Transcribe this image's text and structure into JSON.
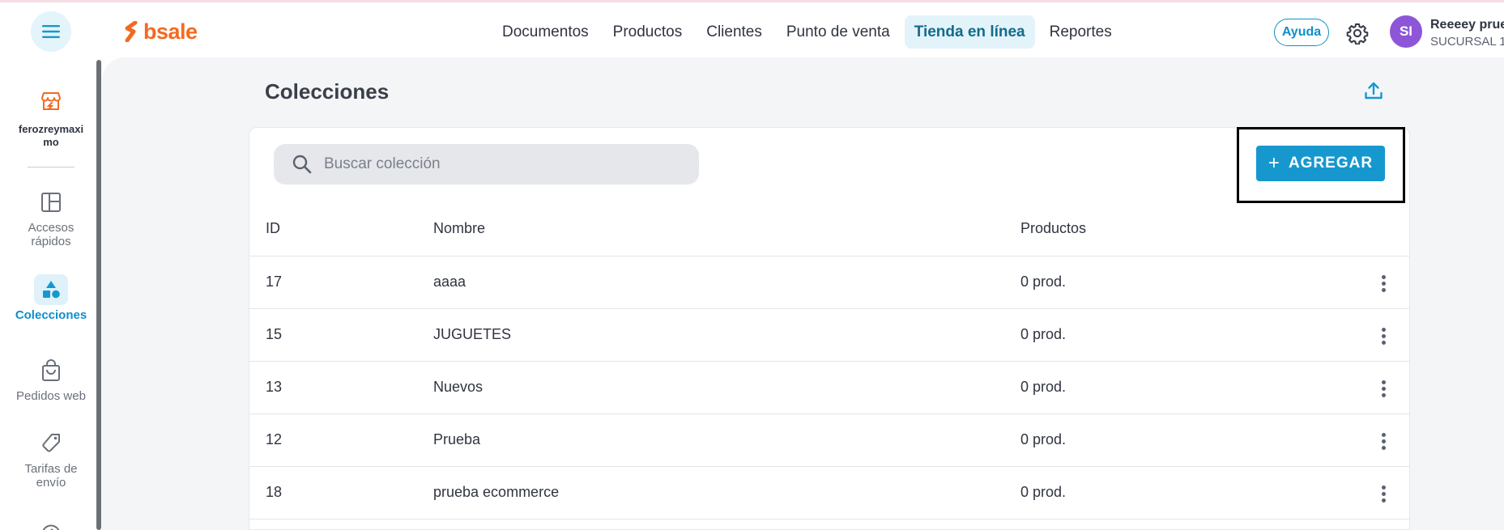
{
  "header": {
    "logo_text": "bsale",
    "nav": [
      {
        "label": "Documentos",
        "active": false
      },
      {
        "label": "Productos",
        "active": false
      },
      {
        "label": "Clientes",
        "active": false
      },
      {
        "label": "Punto de venta",
        "active": false
      },
      {
        "label": "Tienda en línea",
        "active": true
      },
      {
        "label": "Reportes",
        "active": false
      }
    ],
    "help_label": "Ayuda",
    "avatar_initials": "SI",
    "user_name": "Reeeey prue",
    "user_branch": "SUCURSAL 1"
  },
  "sidebar": {
    "store_name": "ferozreymaxi mo",
    "items": [
      {
        "label": "Accesos rápidos",
        "icon": "layout-icon",
        "active": false
      },
      {
        "label": "Colecciones",
        "icon": "shapes-icon",
        "active": true
      },
      {
        "label": "Pedidos web",
        "icon": "shopping-bag-icon",
        "active": false
      },
      {
        "label": "Tarifas de envío",
        "icon": "tag-icon",
        "active": false
      }
    ]
  },
  "main": {
    "title": "Colecciones",
    "search_placeholder": "Buscar colección",
    "add_label": "AGREGAR",
    "add_symbol": "+",
    "table": {
      "headers": [
        "ID",
        "Nombre",
        "Productos"
      ],
      "rows": [
        {
          "id": "17",
          "name": "aaaa",
          "products": "0 prod."
        },
        {
          "id": "15",
          "name": "JUGUETES",
          "products": "0 prod."
        },
        {
          "id": "13",
          "name": "Nuevos",
          "products": "0 prod."
        },
        {
          "id": "12",
          "name": "Prueba",
          "products": "0 prod."
        },
        {
          "id": "18",
          "name": "prueba ecommerce",
          "products": "0 prod."
        }
      ]
    }
  },
  "colors": {
    "brand_orange": "#f26a21",
    "accent_blue": "#1698cf",
    "active_nav_bg": "#e3f3fa",
    "avatar_purple": "#8d55d8"
  }
}
